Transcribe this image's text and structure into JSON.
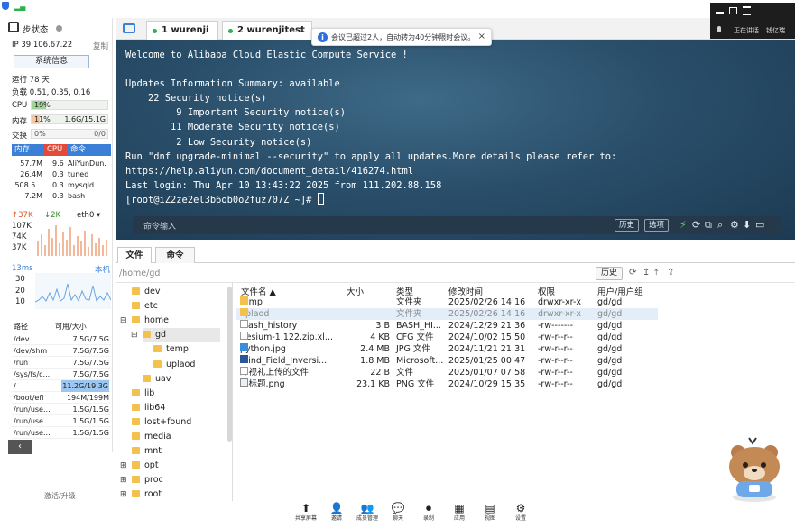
{
  "sidebar": {
    "title": "步状态",
    "ip": "IP 39.106.67.22",
    "copy_label": "复制",
    "sysinfo_button": "系统信息",
    "uptime": "运行 78 天",
    "load": "负载 0.51, 0.35, 0.16",
    "cpu": {
      "label": "CPU",
      "percent_text": "19%",
      "fraction": 0.19
    },
    "mem": {
      "label": "内存",
      "percent_text": "11%",
      "detail": "1.6G/15.1G",
      "fraction": 0.11
    },
    "swap": {
      "label": "交换",
      "percent_text": "0%",
      "detail": "0/0",
      "fraction": 0.0
    },
    "proc_headers": [
      "内存",
      "CPU",
      "命令"
    ],
    "processes": [
      {
        "mem": "57.7M",
        "cpu": "9.6",
        "cmd": "AliYunDun."
      },
      {
        "mem": "26.4M",
        "cpu": "0.3",
        "cmd": "tuned"
      },
      {
        "mem": "508.5...",
        "cpu": "0.3",
        "cmd": "mysqld"
      },
      {
        "mem": "7.2M",
        "cpu": "0.3",
        "cmd": "bash"
      }
    ],
    "net": {
      "up": "37K",
      "down": "2K",
      "iface": "eth0",
      "levels": [
        "107K",
        "74K",
        "37K"
      ]
    },
    "ping": {
      "ms": "13ms",
      "host": "本机",
      "levels": [
        "30",
        "20",
        "10"
      ]
    },
    "disk_headers": [
      "路径",
      "可用/大小"
    ],
    "disks": [
      {
        "path": "/dev",
        "size": "7.5G/7.5G"
      },
      {
        "path": "/dev/shm",
        "size": "7.5G/7.5G"
      },
      {
        "path": "/run",
        "size": "7.5G/7.5G"
      },
      {
        "path": "/sys/fs/c...",
        "size": "7.5G/7.5G"
      },
      {
        "path": "/",
        "size": "11.2G/19.3G"
      },
      {
        "path": "/boot/efi",
        "size": "194M/199M"
      },
      {
        "path": "/run/use...",
        "size": "1.5G/1.5G"
      },
      {
        "path": "/run/use...",
        "size": "1.5G/1.5G"
      },
      {
        "path": "/run/use...",
        "size": "1.5G/1.5G"
      }
    ],
    "footer": "激活/升级"
  },
  "tabs": [
    {
      "label": "1 wurenji"
    },
    {
      "label": "2 wurenjitest"
    }
  ],
  "toast": {
    "message": "会议已超过2人，自动转为40分钟限时会议。"
  },
  "meeting_widget": {
    "left_label": "正在讲话",
    "right_label": "钱亿瑞"
  },
  "terminal": {
    "lines": [
      "Welcome to Alibaba Cloud Elastic Compute Service !",
      "",
      "Updates Information Summary: available",
      "    22 Security notice(s)",
      "         9 Important Security notice(s)",
      "        11 Moderate Security notice(s)",
      "         2 Low Security notice(s)",
      "Run \"dnf upgrade-minimal --security\" to apply all updates.More details please refer to:",
      "https://help.aliyun.com/document_detail/416274.html",
      "Last login: Thu Apr 10 13:43:22 2025 from 111.202.88.158"
    ],
    "prompt": "[root@iZ2ze2el3b6ob0o2fuz707Z ~]# ",
    "cmd_placeholder": "命令输入",
    "history_button": "历史",
    "options_button": "选项"
  },
  "filemanager": {
    "tabs": [
      "文件",
      "命令"
    ],
    "path": "/home/gd",
    "history_button": "历史",
    "tree": [
      {
        "name": "dev",
        "level": 0,
        "expander": ""
      },
      {
        "name": "etc",
        "level": 0,
        "expander": ""
      },
      {
        "name": "home",
        "level": 0,
        "expander": "⊟"
      },
      {
        "name": "gd",
        "level": 1,
        "expander": "⊟"
      },
      {
        "name": "temp",
        "level": 2,
        "expander": ""
      },
      {
        "name": "uplaod",
        "level": 2,
        "expander": ""
      },
      {
        "name": "uav",
        "level": 1,
        "expander": ""
      },
      {
        "name": "lib",
        "level": 0,
        "expander": ""
      },
      {
        "name": "lib64",
        "level": 0,
        "expander": ""
      },
      {
        "name": "lost+found",
        "level": 0,
        "expander": ""
      },
      {
        "name": "media",
        "level": 0,
        "expander": ""
      },
      {
        "name": "mnt",
        "level": 0,
        "expander": ""
      },
      {
        "name": "opt",
        "level": 0,
        "expander": "⊞"
      },
      {
        "name": "proc",
        "level": 0,
        "expander": "⊞"
      },
      {
        "name": "root",
        "level": 0,
        "expander": "⊞"
      }
    ],
    "columns": [
      "文件名",
      "大小",
      "类型",
      "修改时间",
      "权限",
      "用户/用户组"
    ],
    "files": [
      {
        "name": "temp",
        "size": "",
        "type": "文件夹",
        "mtime": "2025/02/26 14:16",
        "perm": "drwxr-xr-x",
        "owner": "gd/gd",
        "icon": "folder"
      },
      {
        "name": "uplaod",
        "size": "",
        "type": "文件夹",
        "mtime": "2025/02/26 14:16",
        "perm": "drwxr-xr-x",
        "owner": "gd/gd",
        "icon": "folder"
      },
      {
        "name": ".bash_history",
        "size": "3 B",
        "type": "BASH_HI...",
        "mtime": "2024/12/29 21:36",
        "perm": "-rw-------",
        "owner": "gd/gd",
        "icon": "file"
      },
      {
        "name": "Cesium-1.122.zip.xl...",
        "size": "4 KB",
        "type": "CFG 文件",
        "mtime": "2024/10/02 15:50",
        "perm": "-rw-r--r--",
        "owner": "gd/gd",
        "icon": "file"
      },
      {
        "name": "python.jpg",
        "size": "2.4 MB",
        "type": "JPG 文件",
        "mtime": "2024/11/21 21:31",
        "perm": "-rw-r--r--",
        "owner": "gd/gd",
        "icon": "image"
      },
      {
        "name": "Wind_Field_Inversi...",
        "size": "1.8 MB",
        "type": "Microsoft...",
        "mtime": "2025/01/25 00:47",
        "perm": "-rw-r--r--",
        "owner": "gd/gd",
        "icon": "doc"
      },
      {
        "name": "邱视礼上传的文件",
        "size": "22 B",
        "type": "文件",
        "mtime": "2025/01/07 07:58",
        "perm": "-rw-r--r--",
        "owner": "gd/gd",
        "icon": "file"
      },
      {
        "name": "无标题.png",
        "size": "23.1 KB",
        "type": "PNG 文件",
        "mtime": "2024/10/29 15:35",
        "perm": "-rw-r--r--",
        "owner": "gd/gd",
        "icon": "png"
      }
    ]
  },
  "meeting_bar": {
    "items": [
      {
        "label": "共享屏幕",
        "icon": "share-screen-icon",
        "glyph": "⬆"
      },
      {
        "label": "邀请",
        "icon": "invite-icon",
        "glyph": "👤"
      },
      {
        "label": "成员管理",
        "icon": "members-icon",
        "glyph": "👥"
      },
      {
        "label": "聊天",
        "icon": "chat-icon",
        "glyph": "💬"
      },
      {
        "label": "录制",
        "icon": "record-icon",
        "glyph": "⏺"
      },
      {
        "label": "应用",
        "icon": "apps-icon",
        "glyph": "▦"
      },
      {
        "label": "视图",
        "icon": "view-icon",
        "glyph": "▤"
      },
      {
        "label": "设置",
        "icon": "settings-icon",
        "glyph": "⚙"
      }
    ]
  },
  "colors": {
    "accent": "#3c7fd6",
    "cpu_fill": "#9fd39a",
    "mem_fill": "#f4c7a0",
    "proc_header": "#3c7fd6",
    "proc_cpu_header": "#e24b3a",
    "disk_highlight": "#9cc5ef"
  }
}
